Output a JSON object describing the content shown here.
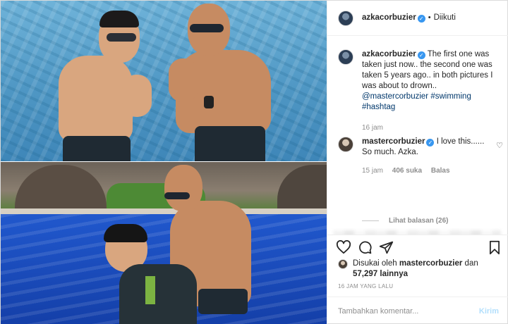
{
  "header": {
    "username": "azkacorbuzier",
    "separator": "•",
    "follow_status": "Diikuti"
  },
  "caption": {
    "username": "azkacorbuzier",
    "text": "The first one was taken just now.. the second one was taken 5 years ago.. in both pictures I was about to drown..",
    "mention": "@mastercorbuzier",
    "tags": [
      "#swimming",
      "#hashtag"
    ],
    "time": "16 jam"
  },
  "comment": {
    "username": "mastercorbuzier",
    "text": "I love this...... So much. Azka.",
    "time": "15 jam",
    "likes": "406 suka",
    "reply": "Balas",
    "view_replies": "Lihat balasan (26)"
  },
  "likes": {
    "prefix": "Disukai oleh",
    "user": "mastercorbuzier",
    "joiner": "dan",
    "count": "57,297 lainnya"
  },
  "timestamp": "16 JAM YANG LALU",
  "composer": {
    "placeholder": "Tambahkan komentar...",
    "post_label": "Kirim"
  },
  "icons": {
    "like": "heart-icon",
    "comment": "comment-icon",
    "share": "share-icon",
    "save": "bookmark-icon"
  }
}
